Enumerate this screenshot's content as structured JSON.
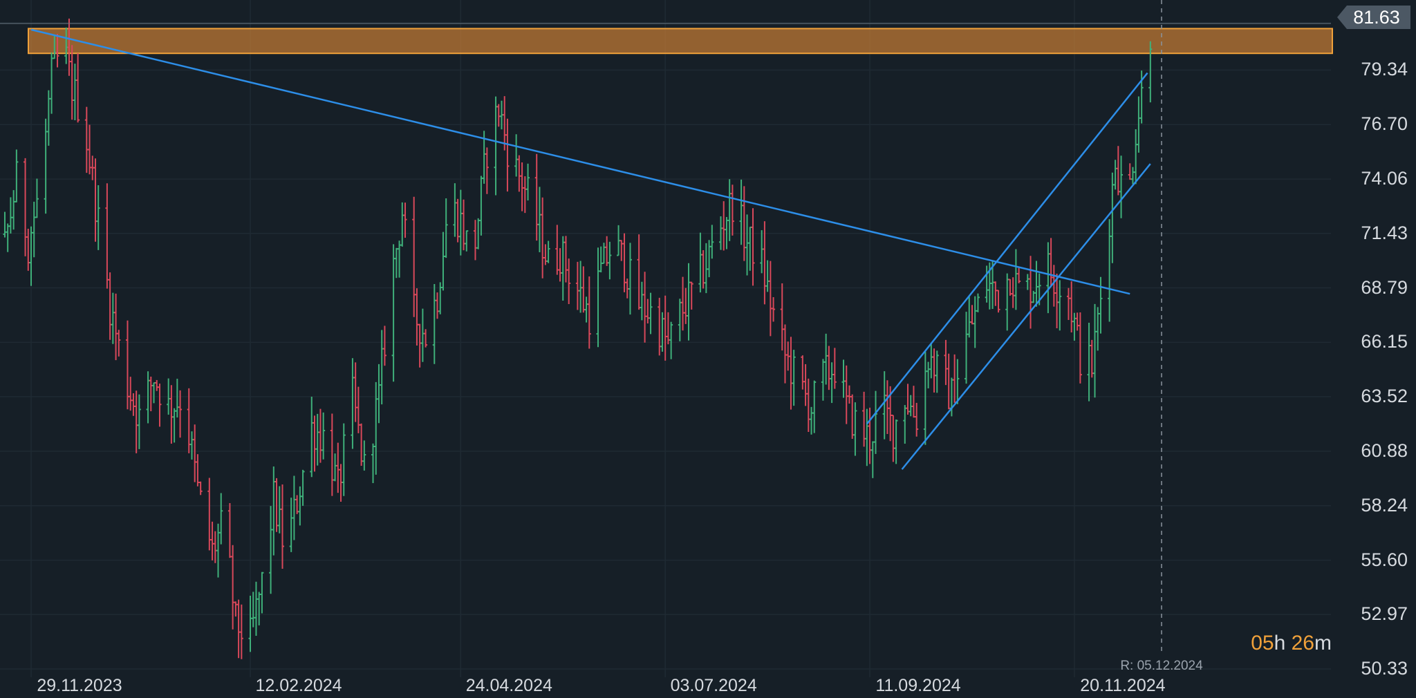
{
  "chart_data": {
    "type": "ohlc",
    "title": "",
    "xlabel": "",
    "ylabel": "",
    "ylim": [
      49.5,
      82.4
    ],
    "x_tick_labels": [
      "29.11.2023",
      "12.02.2024",
      "24.04.2024",
      "03.07.2024",
      "11.09.2024",
      "20.11.2024"
    ],
    "y_tick_labels": [
      "50.33",
      "52.97",
      "55.60",
      "58.24",
      "60.88",
      "63.52",
      "66.15",
      "68.79",
      "71.43",
      "74.06",
      "76.70",
      "79.34",
      "81.63"
    ],
    "grid": true,
    "last_price": "81.63",
    "countdown": {
      "hours": "05",
      "h_unit": "h",
      "minutes": "26",
      "m_unit": "m"
    },
    "cursor_label": "R: 05.12.2024",
    "resistance_zone": {
      "low": 80.15,
      "high": 81.35,
      "color": "#f0a13a"
    },
    "trendlines": [
      {
        "name": "",
        "from": [
          "2023-11-29",
          81.3
        ],
        "to": [
          "2024-12-09",
          68.5
        ]
      },
      {
        "name": "",
        "from": [
          "2024-09-10",
          62.2
        ],
        "to": [
          "2024-12-15",
          79.2
        ]
      },
      {
        "name": "",
        "from": [
          "2024-09-22",
          60.0
        ],
        "to": [
          "2024-12-16",
          74.8
        ]
      }
    ],
    "colors": {
      "up": "#3fb07a",
      "down": "#d8485a",
      "trend": "#2d8ee8",
      "zone": "#f0a13a"
    },
    "anchors": [
      [
        "2023-10-28",
        78.0
      ],
      [
        "2023-11-02",
        77.0
      ],
      [
        "2023-11-07",
        73.5
      ],
      [
        "2023-11-11",
        70.5
      ],
      [
        "2023-11-15",
        71.5
      ],
      [
        "2023-11-19",
        70.0
      ],
      [
        "2023-11-24",
        74.0
      ],
      [
        "2023-11-28",
        71.0
      ],
      [
        "2023-12-02",
        73.5
      ],
      [
        "2023-12-06",
        79.0
      ],
      [
        "2023-12-10",
        80.5
      ],
      [
        "2023-12-13",
        78.5
      ],
      [
        "2023-12-17",
        77.0
      ],
      [
        "2023-12-21",
        73.0
      ],
      [
        "2023-12-26",
        68.0
      ],
      [
        "2023-12-31",
        64.5
      ],
      [
        "2024-01-05",
        62.5
      ],
      [
        "2024-01-10",
        64.5
      ],
      [
        "2024-01-15",
        63.0
      ],
      [
        "2024-01-20",
        63.5
      ],
      [
        "2024-01-25",
        59.0
      ],
      [
        "2024-01-30",
        56.0
      ],
      [
        "2024-02-03",
        57.5
      ],
      [
        "2024-02-07",
        52.5
      ],
      [
        "2024-02-12",
        51.8
      ],
      [
        "2024-02-16",
        54.5
      ],
      [
        "2024-02-20",
        58.5
      ],
      [
        "2024-02-24",
        56.0
      ],
      [
        "2024-02-28",
        58.5
      ],
      [
        "2024-03-04",
        62.0
      ],
      [
        "2024-03-09",
        61.5
      ],
      [
        "2024-03-13",
        59.0
      ],
      [
        "2024-03-18",
        63.5
      ],
      [
        "2024-03-22",
        60.0
      ],
      [
        "2024-03-27",
        63.5
      ],
      [
        "2024-03-31",
        69.0
      ],
      [
        "2024-04-04",
        72.5
      ],
      [
        "2024-04-08",
        67.5
      ],
      [
        "2024-04-12",
        66.5
      ],
      [
        "2024-04-16",
        68.5
      ],
      [
        "2024-04-20",
        73.0
      ],
      [
        "2024-04-24",
        72.0
      ],
      [
        "2024-04-28",
        70.0
      ],
      [
        "2024-05-03",
        75.5
      ],
      [
        "2024-05-07",
        77.5
      ],
      [
        "2024-05-11",
        75.0
      ],
      [
        "2024-05-15",
        74.0
      ],
      [
        "2024-05-20",
        72.0
      ],
      [
        "2024-05-24",
        70.0
      ],
      [
        "2024-05-28",
        70.5
      ],
      [
        "2024-06-02",
        69.0
      ],
      [
        "2024-06-07",
        67.5
      ],
      [
        "2024-06-11",
        69.5
      ],
      [
        "2024-06-15",
        71.0
      ],
      [
        "2024-06-19",
        70.0
      ],
      [
        "2024-06-24",
        68.0
      ],
      [
        "2024-06-29",
        67.5
      ],
      [
        "2024-07-04",
        66.0
      ],
      [
        "2024-07-08",
        67.5
      ],
      [
        "2024-07-12",
        68.5
      ],
      [
        "2024-07-17",
        70.0
      ],
      [
        "2024-07-21",
        71.5
      ],
      [
        "2024-07-26",
        73.0
      ],
      [
        "2024-07-31",
        71.0
      ],
      [
        "2024-08-04",
        70.5
      ],
      [
        "2024-08-09",
        67.5
      ],
      [
        "2024-08-13",
        65.5
      ],
      [
        "2024-08-18",
        64.0
      ],
      [
        "2024-08-22",
        63.0
      ],
      [
        "2024-08-26",
        64.5
      ],
      [
        "2024-08-30",
        65.0
      ],
      [
        "2024-09-03",
        63.0
      ],
      [
        "2024-09-07",
        62.0
      ],
      [
        "2024-09-11",
        61.5
      ],
      [
        "2024-09-15",
        63.0
      ],
      [
        "2024-09-19",
        62.0
      ],
      [
        "2024-09-23",
        63.5
      ],
      [
        "2024-09-27",
        62.5
      ],
      [
        "2024-10-01",
        65.5
      ],
      [
        "2024-10-05",
        64.5
      ],
      [
        "2024-10-09",
        63.5
      ],
      [
        "2024-10-13",
        66.0
      ],
      [
        "2024-10-17",
        67.5
      ],
      [
        "2024-10-21",
        69.0
      ],
      [
        "2024-10-25",
        68.5
      ],
      [
        "2024-10-29",
        69.5
      ],
      [
        "2024-11-02",
        68.5
      ],
      [
        "2024-11-06",
        69.0
      ],
      [
        "2024-11-10",
        70.0
      ],
      [
        "2024-11-14",
        69.0
      ],
      [
        "2024-11-18",
        68.5
      ],
      [
        "2024-11-22",
        65.5
      ],
      [
        "2024-11-26",
        65.0
      ],
      [
        "2024-11-30",
        69.5
      ],
      [
        "2024-12-04",
        75.0
      ],
      [
        "2024-12-08",
        72.5
      ],
      [
        "2024-12-11",
        76.5
      ],
      [
        "2024-12-14",
        79.0
      ],
      [
        "2024-12-16",
        81.2
      ]
    ]
  }
}
